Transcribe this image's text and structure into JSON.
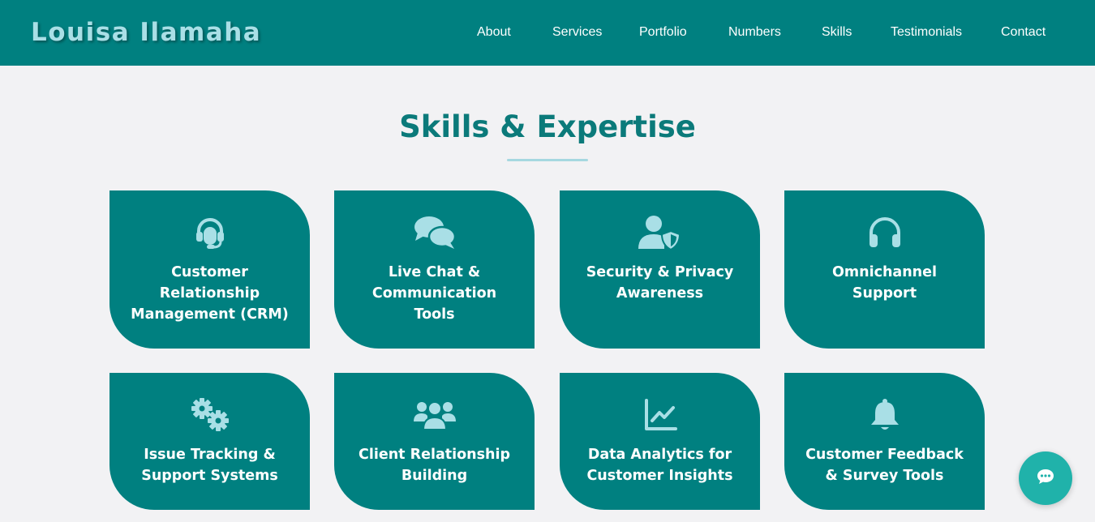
{
  "brand": {
    "name": "Louisa Ilamaha"
  },
  "nav": {
    "items": [
      "About",
      "Services",
      "Portfolio",
      "Numbers",
      "Skills",
      "Testimonials",
      "Contact"
    ]
  },
  "skills": {
    "title": "Skills & Expertise",
    "cards": [
      {
        "label": "Customer\nRelationship\nManagement (CRM)",
        "icon": "headset-icon"
      },
      {
        "label": "Live Chat &\nCommunication\nTools",
        "icon": "chat-bubbles-icon"
      },
      {
        "label": "Security & Privacy\nAwareness",
        "icon": "user-shield-icon"
      },
      {
        "label": "Omnichannel\nSupport",
        "icon": "headphones-icon"
      },
      {
        "label": "Issue Tracking &\nSupport Systems",
        "icon": "gears-icon"
      },
      {
        "label": "Client Relationship\nBuilding",
        "icon": "users-icon"
      },
      {
        "label": "Data Analytics for\nCustomer Insights",
        "icon": "line-chart-icon"
      },
      {
        "label": "Customer Feedback\n& Survey Tools",
        "icon": "bell-icon"
      }
    ]
  },
  "chat_widget": {
    "icon": "comment-dots-icon"
  },
  "colors": {
    "primary": "#008080",
    "accent_light": "#a9dfe6",
    "background": "#f2f2f4",
    "chat_button": "#20b2aa"
  }
}
